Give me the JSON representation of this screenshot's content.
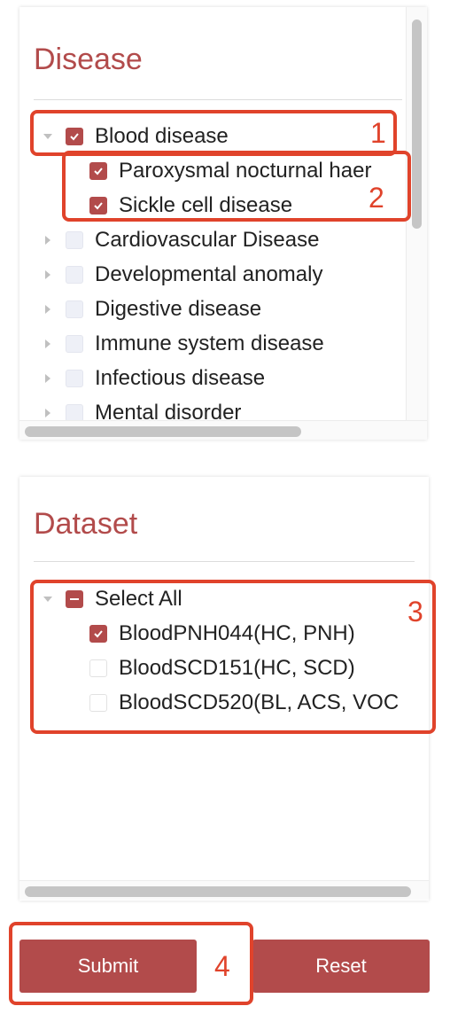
{
  "disease": {
    "title": "Disease",
    "items": [
      {
        "label": "Blood disease",
        "expanded": true,
        "checked": true
      },
      {
        "label": "Paroxysmal nocturnal haer",
        "checked": true
      },
      {
        "label": "Sickle cell disease",
        "checked": true
      },
      {
        "label": "Cardiovascular Disease",
        "checked": false
      },
      {
        "label": "Developmental anomaly",
        "checked": false
      },
      {
        "label": "Digestive disease",
        "checked": false
      },
      {
        "label": "Immune system disease",
        "checked": false
      },
      {
        "label": "Infectious disease",
        "checked": false
      },
      {
        "label": "Mental disorder",
        "checked": false
      }
    ]
  },
  "dataset": {
    "title": "Dataset",
    "items": [
      {
        "label": "Select All",
        "state": "indeterminate"
      },
      {
        "label": "BloodPNH044(HC, PNH)",
        "checked": true
      },
      {
        "label": "BloodSCD151(HC, SCD)",
        "checked": false
      },
      {
        "label": "BloodSCD520(BL, ACS, VOC",
        "checked": false
      }
    ]
  },
  "buttons": {
    "submit": "Submit",
    "reset": "Reset"
  },
  "annotations": {
    "n1": "1",
    "n2": "2",
    "n3": "3",
    "n4": "4"
  },
  "colors": {
    "accent": "#b24b4b",
    "annotation": "#e0432b"
  }
}
